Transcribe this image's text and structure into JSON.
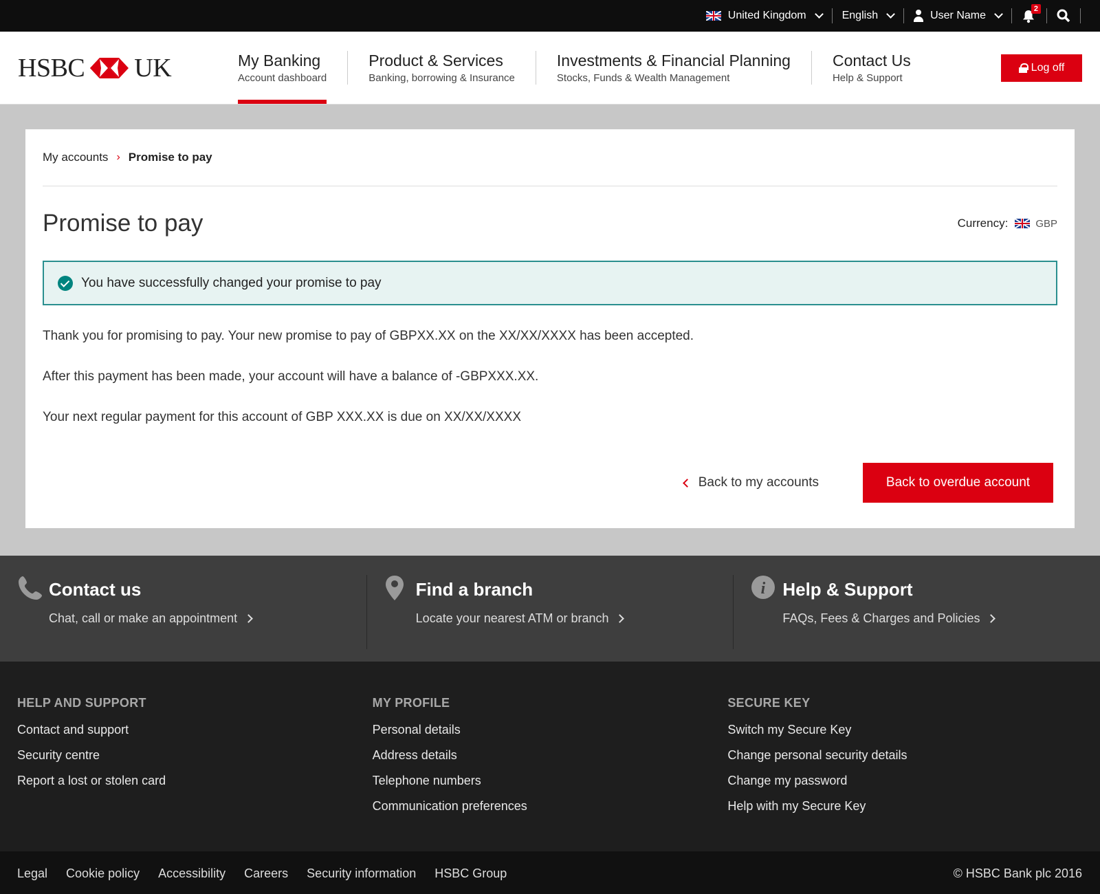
{
  "topbar": {
    "country": "United Kingdom",
    "language": "English",
    "user": "User Name",
    "notifications": "2"
  },
  "header": {
    "logo_left": "HSBC",
    "logo_right": "UK",
    "nav": [
      {
        "title": "My Banking",
        "subtitle": "Account dashboard"
      },
      {
        "title": "Product & Services",
        "subtitle": "Banking, borrowing & Insurance"
      },
      {
        "title": "Investments & Financial Planning",
        "subtitle": "Stocks, Funds & Wealth Management"
      },
      {
        "title": "Contact Us",
        "subtitle": "Help & Support"
      }
    ],
    "logoff": "Log off"
  },
  "main": {
    "breadcrumb": {
      "parent": "My accounts",
      "sep": "›",
      "current": "Promise to pay"
    },
    "title": "Promise to pay",
    "currency_label": "Currency:",
    "currency_code": "GBP",
    "success_message": "You have successfully changed your promise to pay",
    "paragraphs": [
      "Thank you for promising to pay. Your new promise to pay of GBPXX.XX on the XX/XX/XXXX has been accepted.",
      "After this payment has been made, your account will have a balance of  -GBPXXX.XX.",
      "Your next regular payment for this account of GBP XXX.XX is due on XX/XX/XXXX"
    ],
    "back_link": "Back to my accounts",
    "primary_button": "Back to overdue account"
  },
  "quick_links": [
    {
      "title": "Contact us",
      "subtitle": "Chat, call or make an appointment"
    },
    {
      "title": "Find a branch",
      "subtitle": "Locate your nearest ATM or branch"
    },
    {
      "title": "Help & Support",
      "subtitle": "FAQs, Fees & Charges and Policies"
    }
  ],
  "footer_columns": [
    {
      "heading": "HELP AND SUPPORT",
      "links": [
        "Contact and support",
        "Security centre",
        "Report a lost or stolen card"
      ]
    },
    {
      "heading": "MY PROFILE",
      "links": [
        "Personal details",
        "Address details",
        "Telephone numbers",
        "Communication preferences"
      ]
    },
    {
      "heading": "SECURE KEY",
      "links": [
        "Switch my Secure Key",
        "Change personal security details",
        "Change my password",
        "Help with my Secure Key"
      ]
    }
  ],
  "bottom": {
    "links": [
      "Legal",
      "Cookie policy",
      "Accessibility",
      "Careers",
      "Security information",
      "HSBC Group"
    ],
    "copyright": "© HSBC Bank plc 2016"
  },
  "colors": {
    "brand_red": "#db0011",
    "success_teal": "#00847f"
  }
}
